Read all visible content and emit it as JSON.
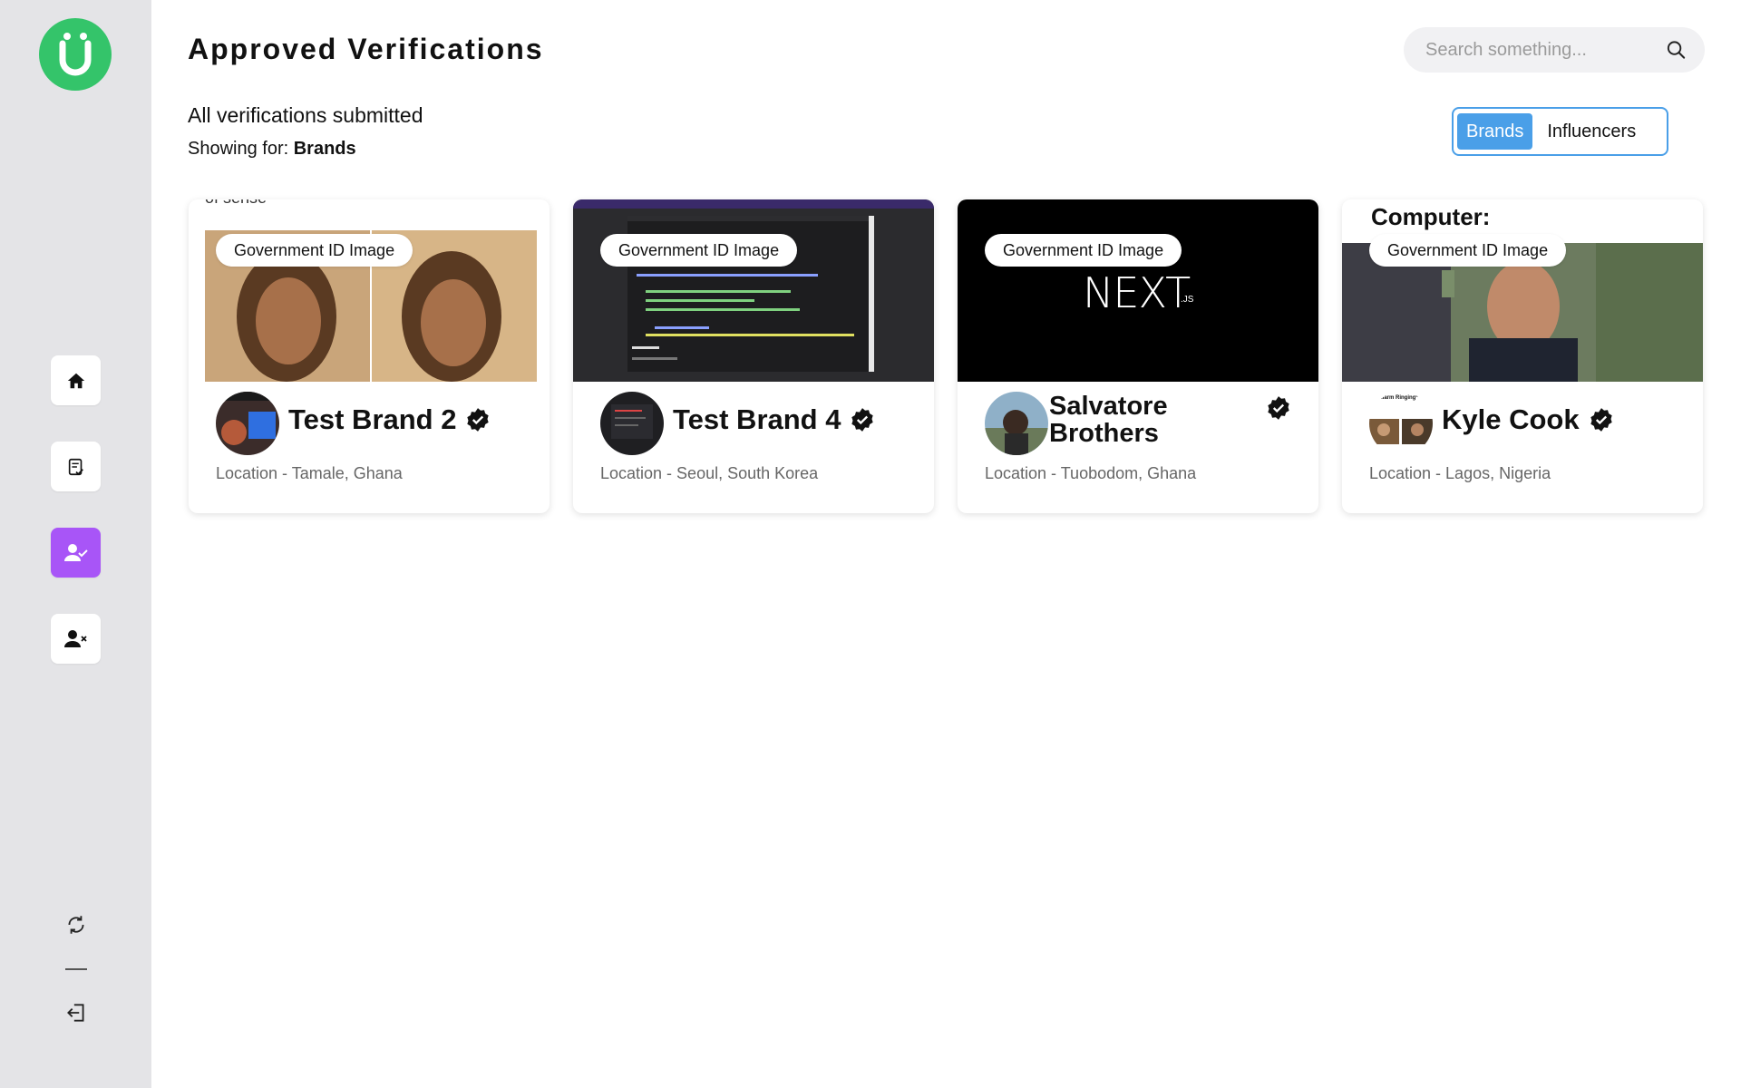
{
  "sidebar": {
    "logo_letter": "Ü",
    "logo_color": "#34c46a",
    "nav": [
      {
        "icon": "home-icon"
      },
      {
        "icon": "document-check-icon"
      },
      {
        "icon": "user-check-icon",
        "active": true
      },
      {
        "icon": "user-x-icon"
      }
    ],
    "bottom": [
      {
        "icon": "refresh-icon"
      },
      {
        "icon": "logout-icon"
      }
    ]
  },
  "header": {
    "title": "Approved Verifications",
    "subtitle": "All verifications submitted",
    "showing_prefix": "Showing for: ",
    "showing_value": "Brands"
  },
  "search": {
    "placeholder": "Search something...",
    "value": ""
  },
  "toggle": {
    "options": [
      "Brands",
      "Influencers"
    ],
    "selected": "Brands",
    "accent": "#4a9fe8"
  },
  "cards": [
    {
      "badge": "Government ID Image",
      "name": "Test Brand 2",
      "location": "Location - Tamale, Ghana",
      "overflow_text": "of sense"
    },
    {
      "badge": "Government ID Image",
      "name": "Test Brand 4",
      "location": "Location - Seoul, South Korea"
    },
    {
      "badge": "Government ID Image",
      "name": "Salvatore Brothers",
      "location": "Location - Tuobodom, Ghana",
      "image_text": "NEXT",
      "image_sub": ".JS"
    },
    {
      "badge": "Government ID Image",
      "name": "Kyle Cook",
      "location": "Location - Lagos, Nigeria",
      "header_text": "Computer:",
      "avatar_caption": "*Alarm Ringing*"
    }
  ]
}
